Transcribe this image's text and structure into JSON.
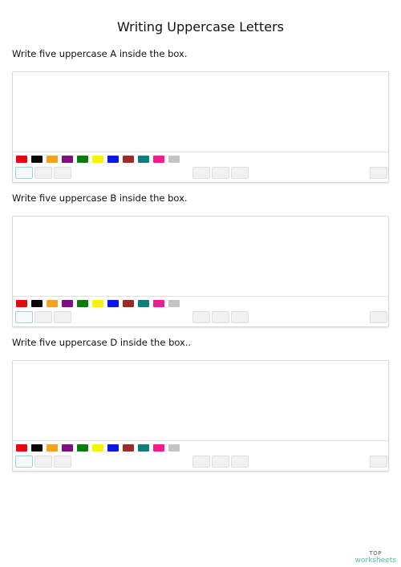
{
  "page": {
    "title": "Writing Uppercase Letters"
  },
  "sections": [
    {
      "prompt": "Write five uppercase A inside the box."
    },
    {
      "prompt": "Write five uppercase B inside the box."
    },
    {
      "prompt": "Write five uppercase D inside the box.."
    }
  ],
  "palette": [
    {
      "name": "red",
      "hex": "#e30b0b"
    },
    {
      "name": "black",
      "hex": "#050505"
    },
    {
      "name": "orange",
      "hex": "#f7a21b"
    },
    {
      "name": "purple",
      "hex": "#7d0f82"
    },
    {
      "name": "green",
      "hex": "#087d08"
    },
    {
      "name": "yellow",
      "hex": "#f6f20b"
    },
    {
      "name": "blue",
      "hex": "#0a16f0"
    },
    {
      "name": "brown",
      "hex": "#a02a2a"
    },
    {
      "name": "teal",
      "hex": "#0b7f7f"
    },
    {
      "name": "pink",
      "hex": "#ef1e8f"
    },
    {
      "name": "gray",
      "hex": "#c4c4c4"
    }
  ],
  "tool_icons": [
    "pen-icon",
    "eraser-icon",
    "line-icon",
    "undo-icon",
    "redo-icon",
    "clear-icon",
    "trash-icon"
  ],
  "brand": {
    "top": "TOP",
    "bottom": "worksheets"
  }
}
